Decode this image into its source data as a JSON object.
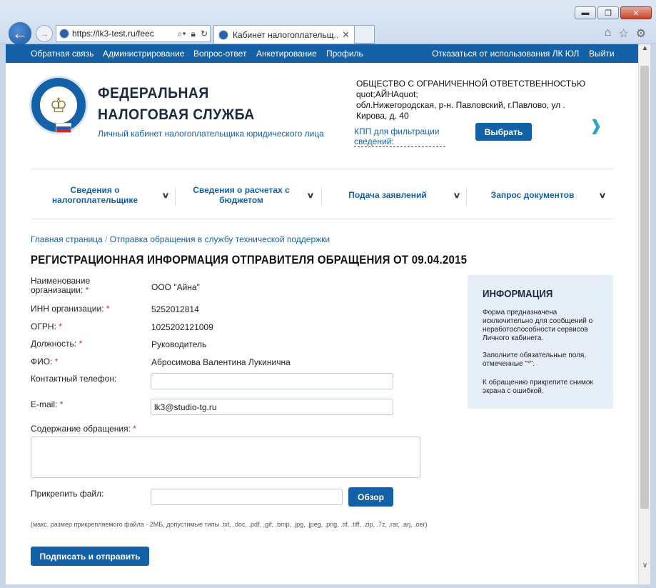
{
  "browser": {
    "url": "https://lk3-test.ru/feec",
    "tab_title": "Кабинет налогоплательщ...",
    "tab_close": "✕",
    "win_min": "▬",
    "win_max": "❐",
    "win_close": "✕"
  },
  "topnav": {
    "feedback": "Обратная связь",
    "admin": "Администрирование",
    "qa": "Вопрос-ответ",
    "survey": "Анкетирование",
    "profile": "Профиль",
    "refuse": "Отказаться от использования ЛК ЮЛ",
    "logout": "Выйти"
  },
  "header": {
    "title_line1": "ФЕДЕРАЛЬНАЯ",
    "title_line2": "НАЛОГОВАЯ СЛУЖБА",
    "subtitle": "Личный кабинет налогоплательщика юридического лица",
    "org_line1": "ОБЩЕСТВО С ОГРАНИЧЕННОЙ ОТВЕТСТВЕННОСТЬЮ",
    "org_line2": "quot;АЙНАquot;",
    "org_line3": "обл.Нижегородская, р-н. Павловский, г.Павлово, ул .",
    "org_line4": "Кирова, д. 40",
    "kpp_link": "КПП для фильтрации сведений:",
    "choose_button": "Выбрать"
  },
  "menu": {
    "item1": "Сведения о налогоплательщике",
    "item2": "Сведения о расчетах с бюджетом",
    "item3": "Подача заявлений",
    "item4": "Запрос документов"
  },
  "breadcrumb": {
    "home": "Главная страница",
    "separator": "/",
    "current": "Отправка обращения в службу технической поддержки"
  },
  "page_title": "РЕГИСТРАЦИОННАЯ ИНФОРМАЦИЯ ОТПРАВИТЕЛЯ ОБРАЩЕНИЯ ОТ 09.04.2015",
  "form": {
    "org_name_label": "Наименование организации:",
    "org_name_value": "ООО \"Айна\"",
    "inn_label": "ИНН организации:",
    "inn_value": "5252012814",
    "ogrn_label": "ОГРН:",
    "ogrn_value": "1025202121009",
    "position_label": "Должность:",
    "position_value": "Руководитель",
    "fio_label": "ФИО:",
    "fio_value": "Абросимова Валентина Лукинична",
    "phone_label": "Контактный телефон:",
    "phone_value": "",
    "email_label": "E-mail:",
    "email_value": "lk3@studio-tg.ru",
    "content_label": "Содержание обращения:",
    "attach_label": "Прикрепить файл:",
    "browse_button": "Обзор",
    "hint": "(макс. размер прикрепляемого файла - 2МБ, допустимые типы .txt, .doc, .pdf, .gif, .bmp, .jpg, .jpeg, .png, .tif, .tiff, .zip, .7z, .rar, .arj, .oer)",
    "required_mark": "*",
    "submit_button": "Подписать и отправить"
  },
  "info": {
    "title": "ИНФОРМАЦИЯ",
    "p1": "Форма предназначена исключительно для сообщений о неработоспособности сервисов Личного кабинета.",
    "p2a": "Заполните обязательные поля, отмеченные \"",
    "p2b": "\".",
    "p3": "К обращению прикрепите снимок экрана с ошибкой."
  },
  "colors": {
    "brand_blue": "#1461a8",
    "accent_teal": "#2aa7c4",
    "required_red": "#d42b1e",
    "info_bg": "#e6eef8"
  },
  "icons": [
    "back-arrow-icon",
    "forward-arrow-icon",
    "search-icon",
    "lock-icon",
    "refresh-icon",
    "home-icon",
    "star-icon",
    "gear-icon",
    "chevron-right-icon",
    "chevron-down-icon"
  ]
}
